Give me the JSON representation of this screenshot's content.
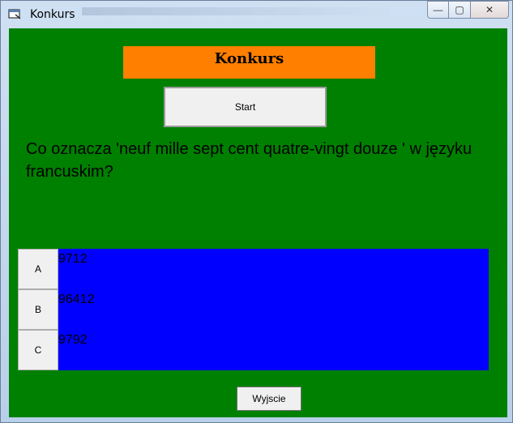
{
  "window": {
    "title": "Konkurs",
    "minimize_glyph": "—",
    "maximize_glyph": "▢",
    "close_glyph": "✕"
  },
  "app": {
    "heading": "Konkurs",
    "start_label": "Start",
    "question": "Co oznacza  'neuf mille sept cent quatre-vingt douze ' w języku francuskim?",
    "answers": [
      {
        "key": "A",
        "text": "9712"
      },
      {
        "key": "B",
        "text": "96412"
      },
      {
        "key": "C",
        "text": "9792"
      }
    ],
    "exit_label": "Wyjscie"
  },
  "colors": {
    "background": "#008000",
    "banner": "#ff8000",
    "answers_panel": "#0000ff"
  }
}
